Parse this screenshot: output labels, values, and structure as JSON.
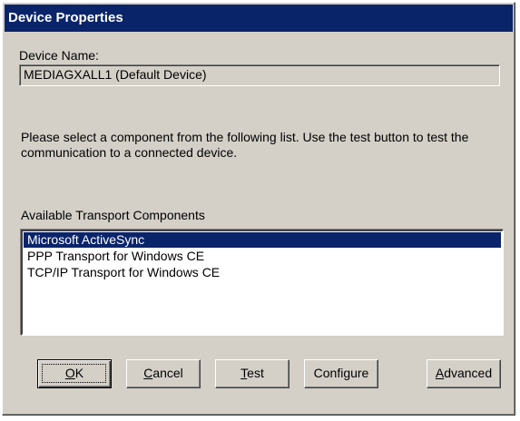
{
  "window": {
    "title": "Device Properties"
  },
  "device_name": {
    "label": "Device Name:",
    "value": "MEDIAGXALL1 (Default Device)"
  },
  "instructions": "Please select a component from the following list.  Use the test button to test the communication to a connected device.",
  "transport": {
    "label": "Available Transport Components",
    "items": [
      {
        "label": "Microsoft ActiveSync",
        "selected": true
      },
      {
        "label": "PPP Transport for Windows CE",
        "selected": false
      },
      {
        "label": "TCP/IP Transport for Windows CE",
        "selected": false
      }
    ]
  },
  "buttons": {
    "ok": {
      "mnemonic": "O",
      "rest": "K"
    },
    "cancel": {
      "mnemonic": "C",
      "rest": "ancel"
    },
    "test": {
      "mnemonic": "T",
      "rest": "est"
    },
    "configure": {
      "label": "Configure"
    },
    "advanced": {
      "mnemonic": "A",
      "rest": "dvanced"
    }
  },
  "colors": {
    "titlebar": "#0a246a",
    "face": "#d4d0c8",
    "selection": "#0a246a"
  }
}
